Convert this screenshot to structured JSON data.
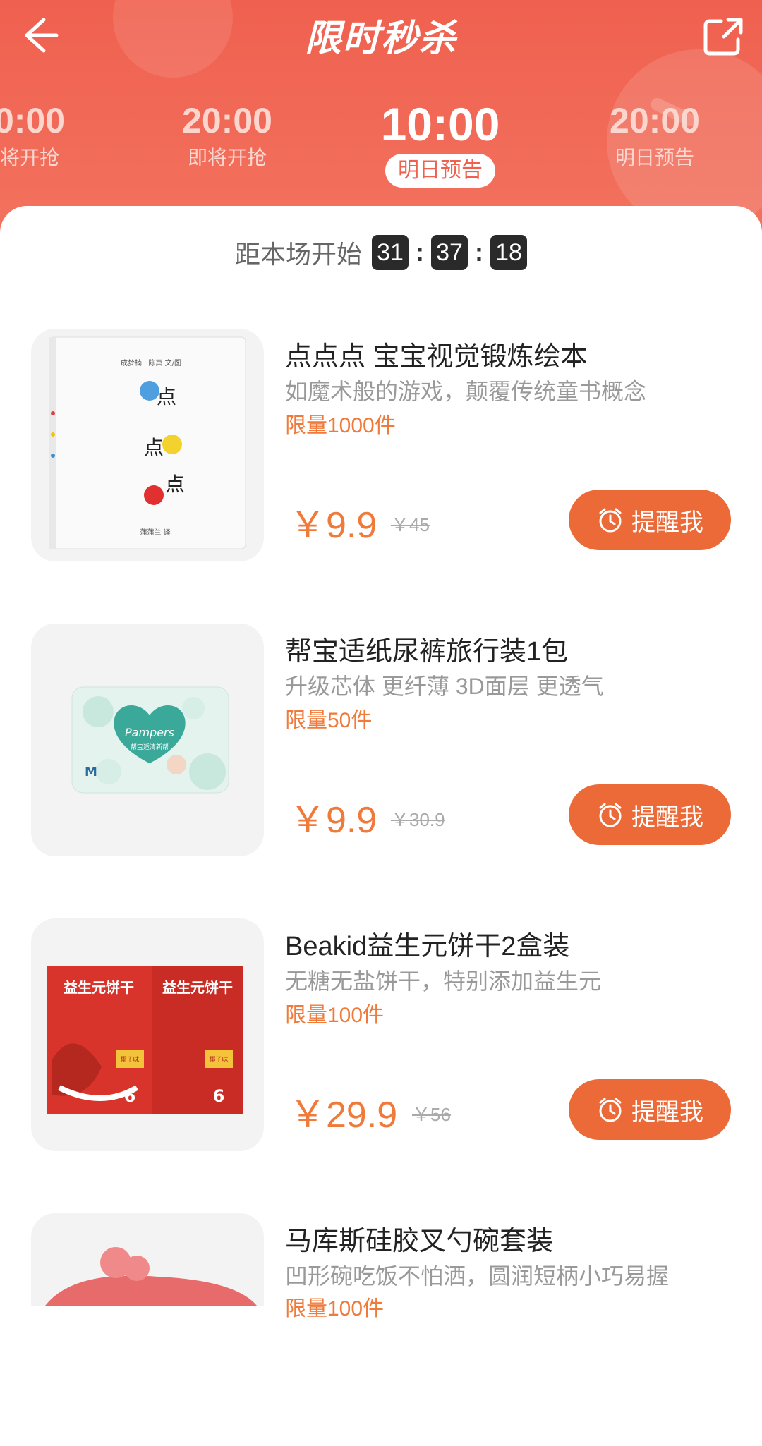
{
  "header": {
    "title": "限时秒杀",
    "slots": [
      {
        "time": "0:00",
        "status": "将开抢"
      },
      {
        "time": "20:00",
        "status": "即将开抢"
      },
      {
        "time": "10:00",
        "status": "明日预告"
      },
      {
        "time": "20:00",
        "status": "明日预告"
      }
    ]
  },
  "countdown": {
    "label": "距本场开始",
    "h": "31",
    "m": "37",
    "s": "18"
  },
  "items": [
    {
      "name": "点点点 宝宝视觉锻炼绘本",
      "desc": "如魔术般的游戏，颠覆传统童书概念",
      "limit": "限量1000件",
      "price": "￥9.9",
      "orig": "￥45",
      "button": "提醒我"
    },
    {
      "name": "帮宝适纸尿裤旅行装1包",
      "desc": "升级芯体 更纤薄 3D面层 更透气",
      "limit": "限量50件",
      "price": "￥9.9",
      "orig": "￥30.9",
      "button": "提醒我"
    },
    {
      "name": "Beakid益生元饼干2盒装",
      "desc": "无糖无盐饼干，特别添加益生元",
      "limit": "限量100件",
      "price": "￥29.9",
      "orig": "￥56",
      "button": "提醒我"
    },
    {
      "name": "马库斯硅胶叉勺碗套装",
      "desc": "凹形碗吃饭不怕洒，圆润短柄小巧易握",
      "limit": "限量100件",
      "price": "",
      "orig": "",
      "button": ""
    }
  ],
  "images": {
    "item1": {
      "cover_text_top": "成梦楠 · 陈冥 文/图",
      "cover_words": [
        "点",
        "点",
        "点"
      ],
      "cover_text_bottom": "蒲蒲兰 译"
    },
    "item2": {
      "brand": "Pampers",
      "sub": "帮宝适清新帮",
      "size": "M"
    },
    "item3": {
      "box_title": "益生元饼干",
      "flavor": "椰子味",
      "count": "6"
    }
  },
  "colors": {
    "primary": "#f0604f",
    "accent": "#ec6a37",
    "price": "#f07a3a"
  }
}
